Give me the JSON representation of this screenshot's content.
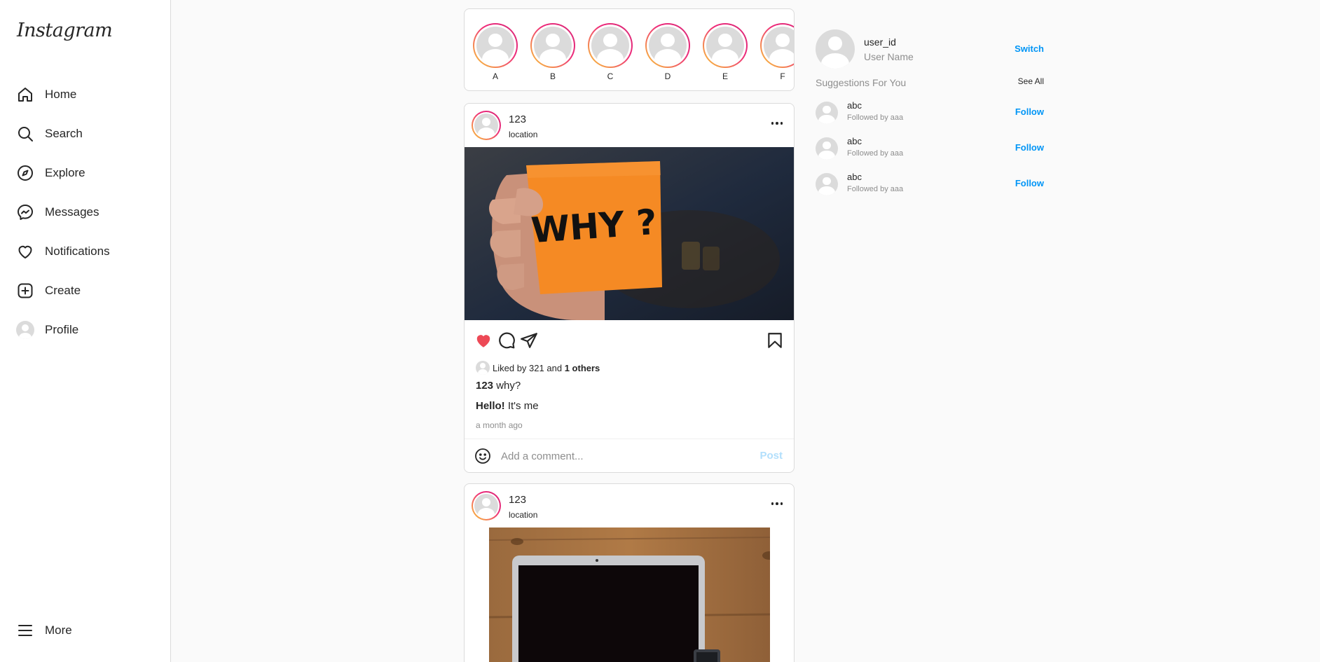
{
  "app": {
    "logo": "Instagram"
  },
  "sidebar": {
    "items": [
      {
        "label": "Home",
        "icon": "home-icon"
      },
      {
        "label": "Search",
        "icon": "search-icon"
      },
      {
        "label": "Explore",
        "icon": "compass-icon"
      },
      {
        "label": "Messages",
        "icon": "messenger-icon"
      },
      {
        "label": "Notifications",
        "icon": "heart-icon"
      },
      {
        "label": "Create",
        "icon": "plus-square-icon"
      },
      {
        "label": "Profile",
        "icon": "avatar"
      }
    ],
    "more": {
      "label": "More",
      "icon": "menu-icon"
    }
  },
  "stories": [
    {
      "name": "A"
    },
    {
      "name": "B"
    },
    {
      "name": "C"
    },
    {
      "name": "D"
    },
    {
      "name": "E"
    },
    {
      "name": "F"
    }
  ],
  "posts": [
    {
      "user": "123",
      "location": "location",
      "image": "orange sticky note reading WHY ?",
      "image_text": "WHY ?",
      "liked": true,
      "likes": {
        "prefix": "Liked by",
        "user": "321",
        "joiner": "and",
        "others": "1 others"
      },
      "caption": {
        "user": "123",
        "text": "why?"
      },
      "comment": {
        "user": "Hello!",
        "text": "It's me"
      },
      "time": "a month ago",
      "comment_placeholder": "Add a comment...",
      "post_label": "Post"
    },
    {
      "user": "123",
      "location": "location",
      "image": "laptop on wooden table"
    }
  ],
  "right_panel": {
    "user_id": "user_id",
    "user_name": "User Name",
    "switch_label": "Switch",
    "suggestions_title": "Suggestions For You",
    "see_all_label": "See All",
    "suggestions": [
      {
        "name": "abc",
        "sub": "Followed by aaa",
        "action": "Follow"
      },
      {
        "name": "abc",
        "sub": "Followed by aaa",
        "action": "Follow"
      },
      {
        "name": "abc",
        "sub": "Followed by aaa",
        "action": "Follow"
      }
    ]
  },
  "colors": {
    "accent": "#0095f6",
    "like": "#ed4956",
    "border": "#dbdbdb"
  }
}
